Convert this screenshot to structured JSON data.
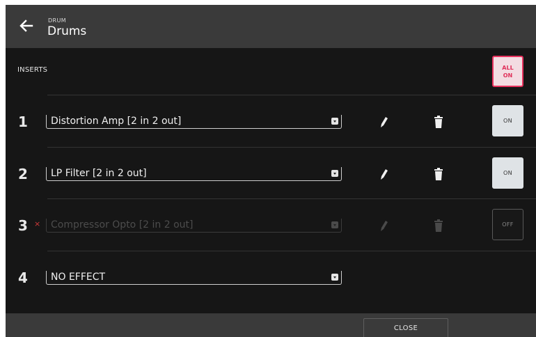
{
  "header": {
    "category": "DRUM",
    "title": "Drums",
    "back_icon": "arrow-left-icon"
  },
  "inserts": {
    "label": "INSERTS",
    "all_on_label": "ALL\nON",
    "all_on_color": "#e8325e"
  },
  "slots": [
    {
      "number": "1",
      "effect": "Distortion Amp [2 in 2 out]",
      "state": "ON",
      "enabled": true,
      "marker": ""
    },
    {
      "number": "2",
      "effect": "LP Filter [2 in 2 out]",
      "state": "ON",
      "enabled": true,
      "marker": ""
    },
    {
      "number": "3",
      "effect": "Compressor Opto [2 in 2 out]",
      "state": "OFF",
      "enabled": false,
      "marker": "×"
    },
    {
      "number": "4",
      "effect": "NO EFFECT",
      "state": "",
      "enabled": true,
      "marker": ""
    }
  ],
  "icons": {
    "edit": "pencil-icon",
    "delete": "trash-icon",
    "dropdown": "dropdown-icon"
  },
  "footer": {
    "close_label": "CLOSE"
  }
}
